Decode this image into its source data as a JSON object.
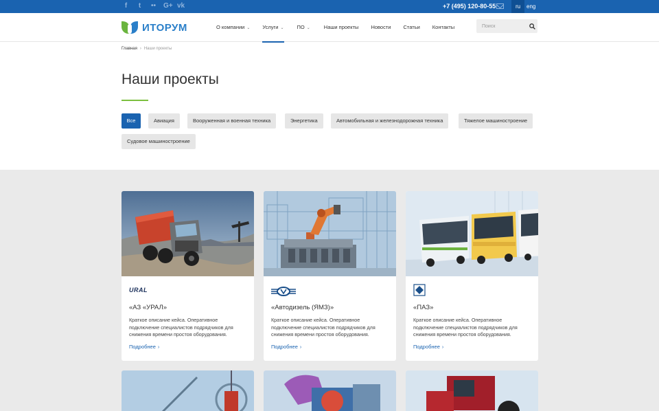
{
  "topbar": {
    "social_icons": [
      "facebook-icon",
      "twitter-icon",
      "flickr-icon",
      "google-plus-icon",
      "vk-icon"
    ],
    "social_glyphs": [
      "f",
      "t",
      "••",
      "G+",
      "vk"
    ],
    "phone": "+7 (495) 120-80-55",
    "lang_ru": "ru",
    "lang_eng": "eng"
  },
  "header": {
    "logo_text": "ИТОРУМ",
    "nav": [
      {
        "label": "О компании",
        "dropdown": true
      },
      {
        "label": "Услуги",
        "dropdown": true
      },
      {
        "label": "ПО",
        "dropdown": true
      },
      {
        "label": "Наши проекты",
        "dropdown": false
      },
      {
        "label": "Новости",
        "dropdown": false
      },
      {
        "label": "Статьи",
        "dropdown": false
      },
      {
        "label": "Контакты",
        "dropdown": false
      }
    ],
    "caret": "⌄",
    "search_placeholder": "Поиск"
  },
  "breadcrumb": {
    "home": "Главная",
    "sep": "›",
    "current": "Наши проекты"
  },
  "page_title": "Наши проекты",
  "filters": [
    "Все",
    "Авиация",
    "Вооруженная и военная техника",
    "Энергетика",
    "Автомобильная и железнодорожная техника",
    "Тяжелое машиностроение",
    "Судовое машиностроение"
  ],
  "cards": [
    {
      "logo_text": "URAL",
      "title": "«АЗ «УРАЛ»",
      "desc": "Краткое описание кейса. Оперативное подключение специалистов подрядчиков для снижения времени простоя оборудования.",
      "more": "Подробнее",
      "chev": "›"
    },
    {
      "logo_text": "ЯМЗ",
      "title": "«Автодизель (ЯМЗ)»",
      "desc": "Краткое описание кейса. Оперативное подключение специалистов подрядчиков для снижения времени простоя оборудования.",
      "more": "Подробнее",
      "chev": "›"
    },
    {
      "logo_text": "ПАЗ",
      "title": "«ПАЗ»",
      "desc": "Краткое описание кейса. Оперативное подключение специалистов подрядчиков для снижения времени простоя оборудования.",
      "more": "Подробнее",
      "chev": "›"
    }
  ],
  "colors": {
    "brand_blue": "#1a63b0",
    "accent_green": "#7cbf3f",
    "grid_bg": "#eaeaea"
  }
}
